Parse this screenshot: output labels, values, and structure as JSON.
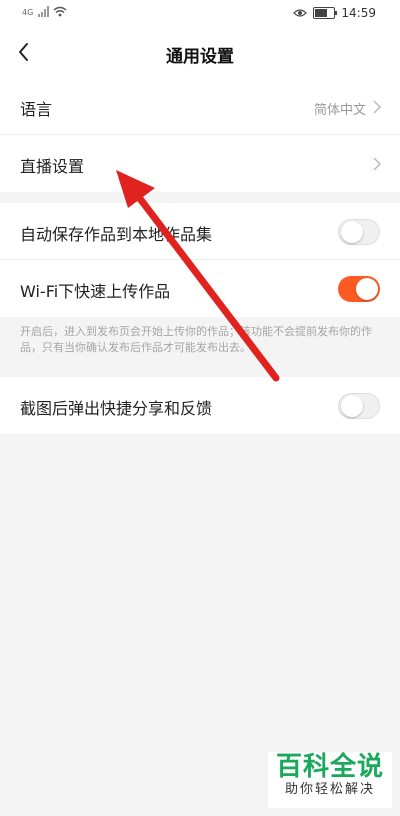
{
  "status_bar": {
    "network_label": "4G",
    "time": "14:59",
    "battery_level": 0.6
  },
  "header": {
    "title": "通用设置",
    "back_icon": "chevron-left-icon"
  },
  "settings": {
    "language": {
      "label": "语言",
      "value": "简体中文"
    },
    "live": {
      "label": "直播设置"
    },
    "auto_save": {
      "label": "自动保存作品到本地作品集",
      "enabled": false
    },
    "wifi_upload": {
      "label": "Wi-Fi下快速上传作品",
      "enabled": true
    },
    "wifi_hint": "开启后，进入到发布页会开始上传你的作品；该功能不会提前发布你的作品，只有当你确认发布后作品才可能发布出去。",
    "screenshot_share": {
      "label": "截图后弹出快捷分享和反馈",
      "enabled": false
    }
  },
  "colors": {
    "accent": "#fe5a22",
    "annotation_arrow": "#e0231f",
    "watermark_green": "#1aa85b"
  },
  "watermark": {
    "title": "百科全说",
    "subtitle": "助你轻松解决"
  }
}
